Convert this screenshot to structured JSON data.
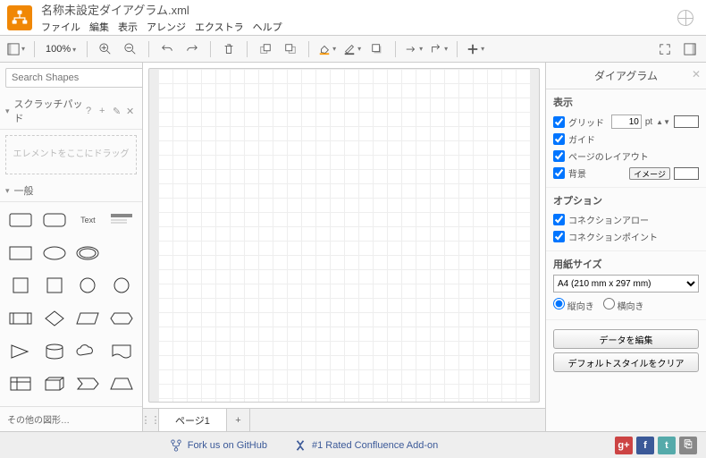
{
  "title": "名称未設定ダイアグラム.xml",
  "menu": [
    "ファイル",
    "編集",
    "表示",
    "アレンジ",
    "エクストラ",
    "ヘルプ"
  ],
  "toolbar": {
    "zoom": "100%"
  },
  "left": {
    "search_placeholder": "Search Shapes",
    "scratchpad_label": "スクラッチパッド",
    "scratchpad_hint": "エレメントをここにドラッグ",
    "general_label": "一般",
    "more_label": "その他の図形…",
    "text_label": "Text"
  },
  "tabs": {
    "page1": "ページ1"
  },
  "right": {
    "title": "ダイアグラム",
    "display_h": "表示",
    "grid": "グリッド",
    "grid_value": "10",
    "grid_unit": "pt",
    "guides": "ガイド",
    "page_layout": "ページのレイアウト",
    "background": "背景",
    "image_btn": "イメージ",
    "options_h": "オプション",
    "conn_arrow": "コネクションアロー",
    "conn_point": "コネクションポイント",
    "paper_h": "用紙サイズ",
    "paper_value": "A4 (210 mm x 297 mm)",
    "portrait": "縦向き",
    "landscape": "横向き",
    "edit_data": "データを編集",
    "clear_style": "デフォルトスタイルをクリア"
  },
  "footer": {
    "github": "Fork us on GitHub",
    "confluence": "#1 Rated Confluence Add-on"
  }
}
